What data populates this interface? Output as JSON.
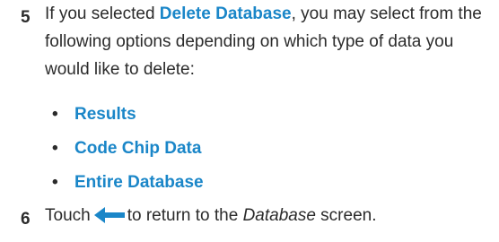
{
  "steps": [
    {
      "number": "5",
      "text_before": "If you selected ",
      "keyword": "Delete Database",
      "text_after": ", you may select from the following options depending on which type of data you would like to delete:",
      "options": [
        {
          "bullet": "•",
          "label": "Results"
        },
        {
          "bullet": "•",
          "label": "Code Chip Data"
        },
        {
          "bullet": "•",
          "label": "Entire Database"
        }
      ]
    },
    {
      "number": "6",
      "text_before": "Touch",
      "icon": "back-arrow-icon",
      "text_middle": "to return to the ",
      "emphasis": "Database",
      "text_after": " screen."
    }
  ],
  "colors": {
    "text": "#2b2b2b",
    "accent": "#1a86c8"
  }
}
